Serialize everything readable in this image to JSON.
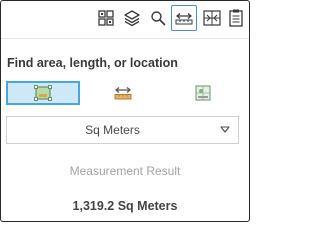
{
  "toolbar": {
    "tools": [
      {
        "icon": "basemap-gallery-icon",
        "active": false
      },
      {
        "icon": "layers-icon",
        "active": false
      },
      {
        "icon": "search-icon",
        "active": false
      },
      {
        "icon": "measurement-icon",
        "active": true
      },
      {
        "icon": "print-icon",
        "active": false
      },
      {
        "icon": "clipboard-icon",
        "active": false
      }
    ]
  },
  "measure": {
    "heading": "Find area, length, or location",
    "modes": [
      {
        "icon": "area-icon",
        "active": true
      },
      {
        "icon": "distance-icon",
        "active": false
      },
      {
        "icon": "location-icon",
        "active": false
      }
    ],
    "unit_selected": "Sq Meters",
    "result_label": "Measurement Result",
    "result_value": "1,319.2 Sq Meters"
  },
  "colors": {
    "accent_border": "#47a6dd",
    "accent_fill": "#cfe8f8",
    "icon_orange": "#c9883a",
    "icon_green": "#7fb27f"
  }
}
